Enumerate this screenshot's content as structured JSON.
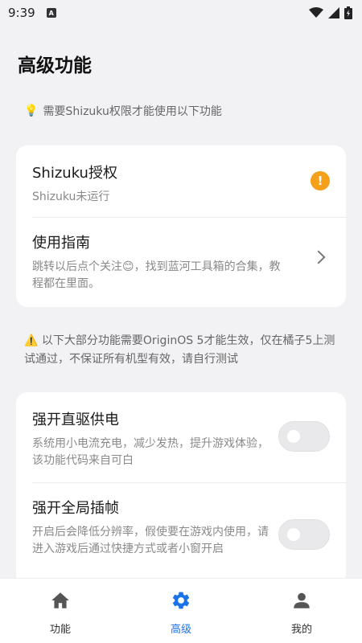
{
  "status_bar": {
    "time": "9:39",
    "indicator": "A"
  },
  "page": {
    "title": "高级功能",
    "tip": "需要Shizuku权限才能使用以下功能",
    "tip_icon": "💡"
  },
  "card1": {
    "shizuku": {
      "title": "Shizuku授权",
      "desc": "Shizuku未运行",
      "badge": "!"
    },
    "guide": {
      "title": "使用指南",
      "desc": "跳转以后点个关注😊，找到蓝河工具箱的合集，教程都在里面。"
    }
  },
  "notice": {
    "icon": "⚠️",
    "text": "以下大部分功能需要OriginOS 5才能生效，仅在橘子5上测试通过，不保证所有机型有效，请自行测试"
  },
  "card2": {
    "power": {
      "title": "强开直驱供电",
      "desc": "系统用小电流充电，减少发热，提升游戏体验，该功能代码来自可白",
      "enabled": false
    },
    "frame": {
      "title": "强开全局插帧",
      "desc": "开启后会降低分辨率，假使要在游戏内使用，请进入游戏后通过快捷方式或者小窗开启",
      "enabled": false
    }
  },
  "bottom_nav": {
    "items": [
      {
        "label": "功能",
        "icon": "home-icon",
        "active": false
      },
      {
        "label": "高级",
        "icon": "gear-icon",
        "active": true
      },
      {
        "label": "我的",
        "icon": "person-icon",
        "active": false
      }
    ]
  },
  "colors": {
    "accent": "#1a73e8",
    "warning": "#f5a01a",
    "background": "#f2f2f5"
  }
}
